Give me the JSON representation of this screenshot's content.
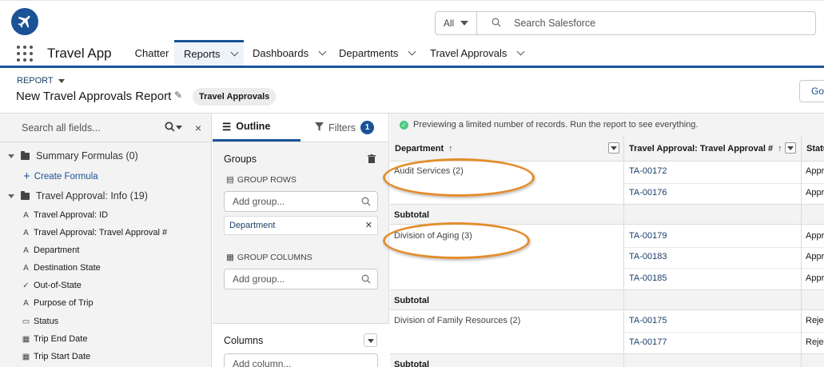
{
  "header": {
    "search_scope": "All",
    "search_placeholder": "Search Salesforce"
  },
  "nav": {
    "app_name": "Travel App",
    "items": [
      {
        "label": "Chatter"
      },
      {
        "label": "Reports"
      },
      {
        "label": "Dashboards"
      },
      {
        "label": "Departments"
      },
      {
        "label": "Travel Approvals"
      }
    ]
  },
  "report": {
    "type_label": "REPORT",
    "title": "New Travel Approvals Report",
    "report_type": "Travel Approvals",
    "right_button": "Go"
  },
  "fields_panel": {
    "search_placeholder": "Search all fields...",
    "summary_folder": "Summary Formulas (0)",
    "create_formula": "Create Formula",
    "info_folder": "Travel Approval: Info (19)",
    "fields": [
      {
        "label": "Travel Approval: ID",
        "icon": "text-icon"
      },
      {
        "label": "Travel Approval: Travel Approval #",
        "icon": "text-icon"
      },
      {
        "label": "Department",
        "icon": "text-icon"
      },
      {
        "label": "Destination State",
        "icon": "text-icon"
      },
      {
        "label": "Out-of-State",
        "icon": "checkbox-icon"
      },
      {
        "label": "Purpose of Trip",
        "icon": "text-icon"
      },
      {
        "label": "Status",
        "icon": "picklist-icon"
      },
      {
        "label": "Trip End Date",
        "icon": "calendar-icon"
      },
      {
        "label": "Trip Start Date",
        "icon": "calendar-icon"
      }
    ]
  },
  "outline": {
    "tab_outline": "Outline",
    "tab_filters": "Filters",
    "filters_count": "1",
    "groups_title": "Groups",
    "group_rows_label": "GROUP ROWS",
    "add_group_placeholder": "Add group...",
    "row_group_chip": "Department",
    "group_columns_label": "GROUP COLUMNS",
    "add_group_columns_placeholder": "Add group...",
    "columns_title": "Columns",
    "add_column_placeholder": "Add column..."
  },
  "preview": {
    "notice": "Previewing a limited number of records. Run the report to see everything.",
    "columns": [
      {
        "label": "Department"
      },
      {
        "label": "Travel Approval: Travel Approval #"
      },
      {
        "label": "Statu"
      }
    ],
    "subtotal_label": "Subtotal",
    "groups": [
      {
        "name": "Audit Services (2)",
        "rows": [
          {
            "id": "TA-00172",
            "status": "Appr"
          },
          {
            "id": "TA-00176",
            "status": "Appr"
          }
        ]
      },
      {
        "name": "Division of Aging (3)",
        "rows": [
          {
            "id": "TA-00179",
            "status": "Appr"
          },
          {
            "id": "TA-00183",
            "status": "Appr"
          },
          {
            "id": "TA-00185",
            "status": "Appr"
          }
        ]
      },
      {
        "name": "Division of Family Resources (2)",
        "rows": [
          {
            "id": "TA-00175",
            "status": "Rejec"
          },
          {
            "id": "TA-00177",
            "status": "Rejec"
          }
        ]
      }
    ]
  },
  "colors": {
    "brand": "#1b5297",
    "annotation": "#e38d2c",
    "success": "#4bca81"
  }
}
